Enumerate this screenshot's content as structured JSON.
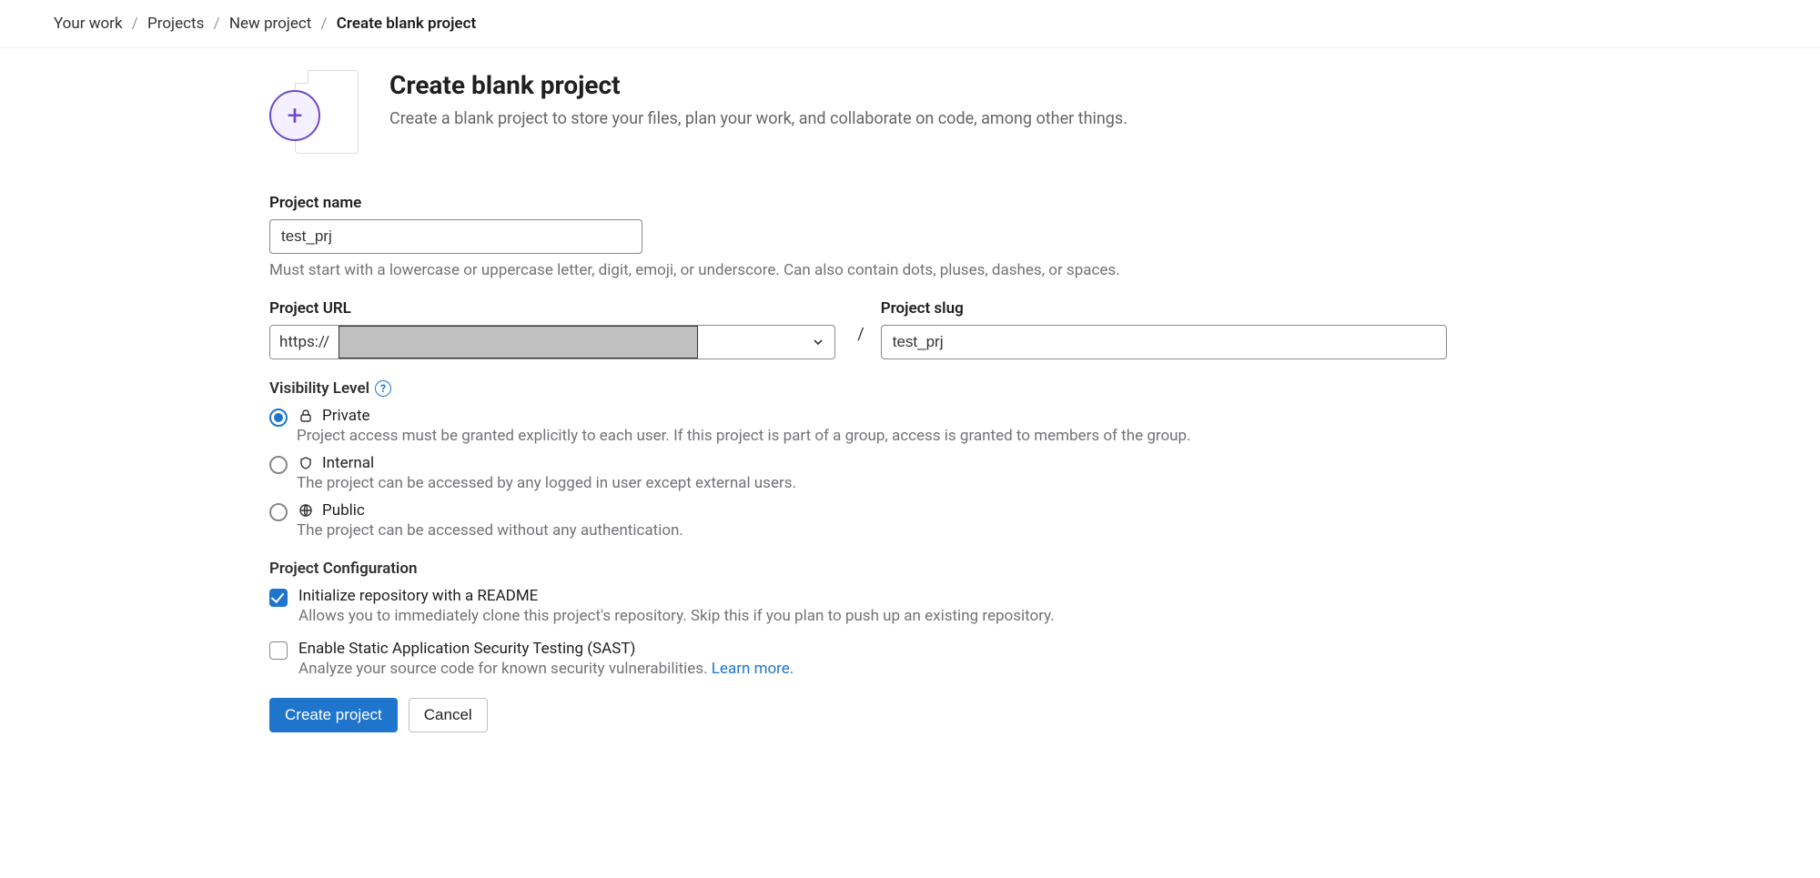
{
  "breadcrumb": {
    "items": [
      "Your work",
      "Projects",
      "New project"
    ],
    "current": "Create blank project"
  },
  "header": {
    "title": "Create blank project",
    "subtitle": "Create a blank project to store your files, plan your work, and collaborate on code, among other things."
  },
  "form": {
    "name_label": "Project name",
    "name_value": "test_prj",
    "name_hint": "Must start with a lowercase or uppercase letter, digit, emoji, or underscore. Can also contain dots, pluses, dashes, or spaces.",
    "url_label": "Project URL",
    "url_prefix": "https://",
    "slash": "/",
    "slug_label": "Project slug",
    "slug_value": "test_prj"
  },
  "visibility": {
    "title": "Visibility Level",
    "options": [
      {
        "label": "Private",
        "desc": "Project access must be granted explicitly to each user. If this project is part of a group, access is granted to members of the group.",
        "checked": true
      },
      {
        "label": "Internal",
        "desc": "The project can be accessed by any logged in user except external users.",
        "checked": false
      },
      {
        "label": "Public",
        "desc": "The project can be accessed without any authentication.",
        "checked": false
      }
    ]
  },
  "config": {
    "title": "Project Configuration",
    "options": [
      {
        "label": "Initialize repository with a README",
        "desc": "Allows you to immediately clone this project's repository. Skip this if you plan to push up an existing repository.",
        "checked": true,
        "link": null
      },
      {
        "label": "Enable Static Application Security Testing (SAST)",
        "desc": "Analyze your source code for known security vulnerabilities. ",
        "checked": false,
        "link": "Learn more."
      }
    ]
  },
  "actions": {
    "primary": "Create project",
    "cancel": "Cancel"
  }
}
